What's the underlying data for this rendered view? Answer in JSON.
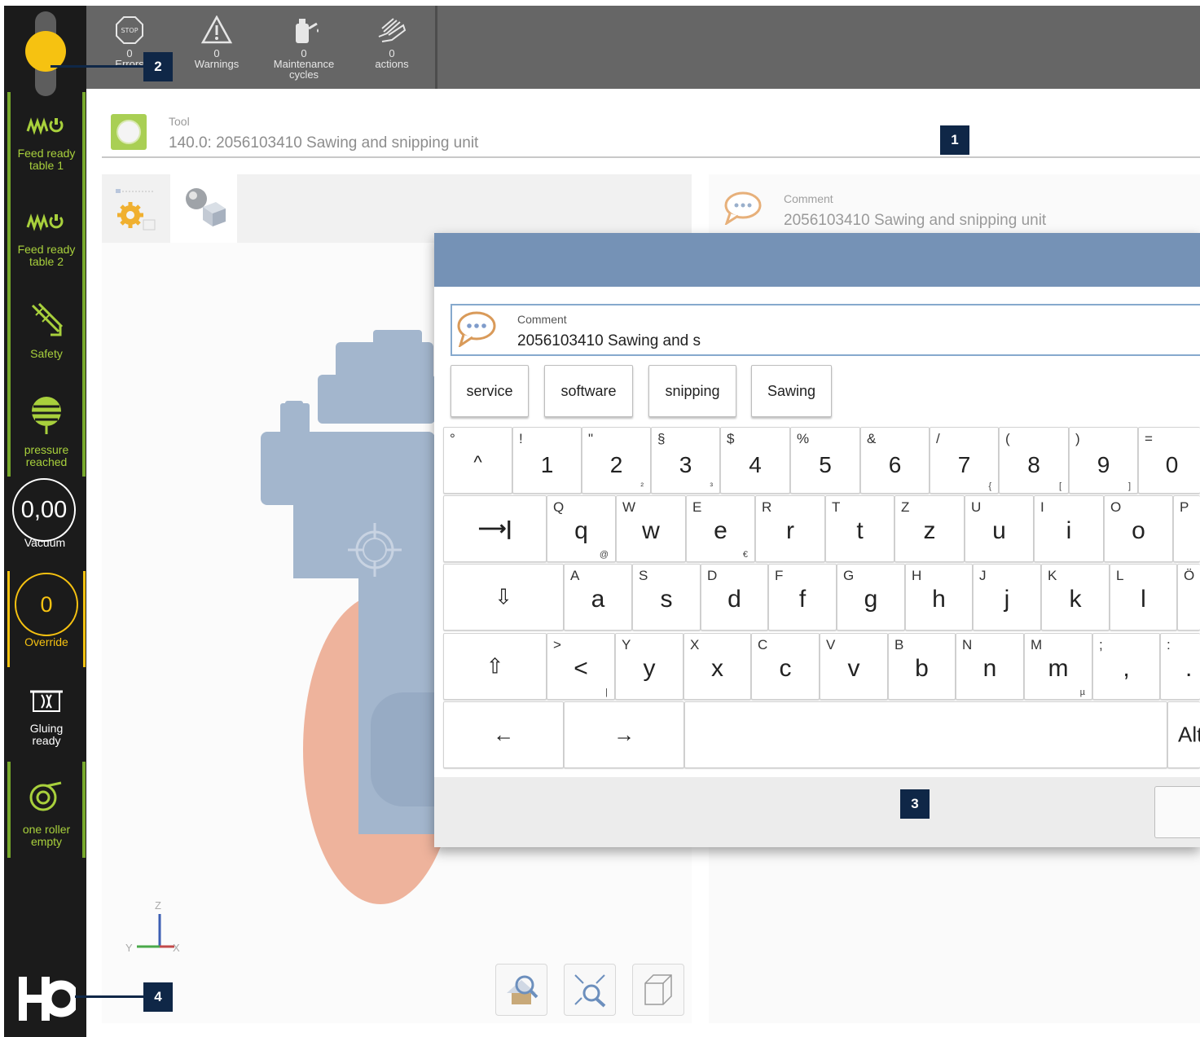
{
  "topbar": {
    "items": [
      {
        "count": "0",
        "label": "Errors",
        "icon": "stop-sign-icon"
      },
      {
        "count": "0",
        "label": "Warnings",
        "icon": "warning-triangle-icon"
      },
      {
        "count": "0",
        "label": "Maintenance cycles",
        "label_line1": "Maintenance",
        "label_line2": "cycles",
        "icon": "oil-can-icon"
      },
      {
        "count": "0",
        "label": "actions",
        "icon": "hand-icon"
      }
    ]
  },
  "sidebar": {
    "signal_light_color": "#f6c211",
    "items": [
      {
        "label_line1": "Feed ready",
        "label_line2": "table 1",
        "icon": "feed-spring-icon"
      },
      {
        "label_line1": "Feed ready",
        "label_line2": "table 2",
        "icon": "feed-spring-icon"
      },
      {
        "label_line1": "Safety",
        "label_line2": "",
        "icon": "safety-arrows-icon"
      },
      {
        "label_line1": "pressure",
        "label_line2": "reached",
        "icon": "pressure-icon"
      },
      {
        "label_line1": "Gluing",
        "label_line2": "ready",
        "icon": "gluing-icon"
      },
      {
        "label_line1": "one roller",
        "label_line2": "empty",
        "icon": "roller-icon"
      }
    ],
    "vacuum": {
      "value": "0,00",
      "label": "Vacuum"
    },
    "override": {
      "value": "0",
      "label": "Override"
    },
    "logo_text": "HO",
    "accent_green": "#a8d03c",
    "accent_amber": "#f6c211"
  },
  "tool": {
    "caption": "Tool",
    "value": "140.0: 2056103410 Sawing and snipping unit"
  },
  "comment_panel": {
    "caption": "Comment",
    "value": "2056103410 Sawing and snipping unit"
  },
  "viewport": {
    "axis_labels": {
      "z": "Z",
      "y": "Y",
      "x": "X"
    },
    "buttons": [
      "home-view-icon",
      "zoom-fit-icon",
      "wireframe-cube-icon"
    ]
  },
  "keyboard_dialog": {
    "input_caption": "Comment",
    "input_value": "2056103410 Sawing and s",
    "suggestions": [
      "service",
      "software",
      "snipping",
      "Sawing"
    ],
    "row1": [
      {
        "main": "^",
        "shift": "°",
        "alt": ""
      },
      {
        "main": "1",
        "shift": "!",
        "alt": ""
      },
      {
        "main": "2",
        "shift": "\"",
        "alt": "²"
      },
      {
        "main": "3",
        "shift": "§",
        "alt": "³"
      },
      {
        "main": "4",
        "shift": "$",
        "alt": ""
      },
      {
        "main": "5",
        "shift": "%",
        "alt": ""
      },
      {
        "main": "6",
        "shift": "&",
        "alt": ""
      },
      {
        "main": "7",
        "shift": "/",
        "alt": "{"
      },
      {
        "main": "8",
        "shift": "(",
        "alt": "["
      },
      {
        "main": "9",
        "shift": ")",
        "alt": "]"
      },
      {
        "main": "0",
        "shift": "=",
        "alt": "}"
      }
    ],
    "row2": [
      {
        "main": "q",
        "shift": "Q",
        "alt": "@"
      },
      {
        "main": "w",
        "shift": "W",
        "alt": ""
      },
      {
        "main": "e",
        "shift": "E",
        "alt": "€"
      },
      {
        "main": "r",
        "shift": "R",
        "alt": ""
      },
      {
        "main": "t",
        "shift": "T",
        "alt": ""
      },
      {
        "main": "z",
        "shift": "Z",
        "alt": ""
      },
      {
        "main": "u",
        "shift": "U",
        "alt": ""
      },
      {
        "main": "i",
        "shift": "I",
        "alt": ""
      },
      {
        "main": "o",
        "shift": "O",
        "alt": ""
      },
      {
        "main": "",
        "shift": "P",
        "alt": ""
      }
    ],
    "row3": [
      {
        "main": "a",
        "shift": "A",
        "alt": ""
      },
      {
        "main": "s",
        "shift": "S",
        "alt": ""
      },
      {
        "main": "d",
        "shift": "D",
        "alt": ""
      },
      {
        "main": "f",
        "shift": "F",
        "alt": ""
      },
      {
        "main": "g",
        "shift": "G",
        "alt": ""
      },
      {
        "main": "h",
        "shift": "H",
        "alt": ""
      },
      {
        "main": "j",
        "shift": "J",
        "alt": ""
      },
      {
        "main": "k",
        "shift": "K",
        "alt": ""
      },
      {
        "main": "l",
        "shift": "L",
        "alt": ""
      },
      {
        "main": "",
        "shift": "Ö",
        "alt": ""
      }
    ],
    "row4": [
      {
        "main": "<",
        "shift": ">",
        "alt": "|"
      },
      {
        "main": "y",
        "shift": "Y",
        "alt": ""
      },
      {
        "main": "x",
        "shift": "X",
        "alt": ""
      },
      {
        "main": "c",
        "shift": "C",
        "alt": ""
      },
      {
        "main": "v",
        "shift": "V",
        "alt": ""
      },
      {
        "main": "b",
        "shift": "B",
        "alt": ""
      },
      {
        "main": "n",
        "shift": "N",
        "alt": ""
      },
      {
        "main": "m",
        "shift": "M",
        "alt": "µ"
      },
      {
        "main": ",",
        "shift": ";",
        "alt": ""
      },
      {
        "main": ".",
        "shift": ":",
        "alt": ""
      }
    ],
    "tab_glyph": "⟶|",
    "capslock_glyph": "⇩",
    "shift_glyph": "⇧",
    "left_glyph": "←",
    "right_glyph": "→",
    "alt_label": "Alt",
    "header_color": "#7592b6"
  },
  "callouts": [
    "1",
    "2",
    "3",
    "4"
  ]
}
